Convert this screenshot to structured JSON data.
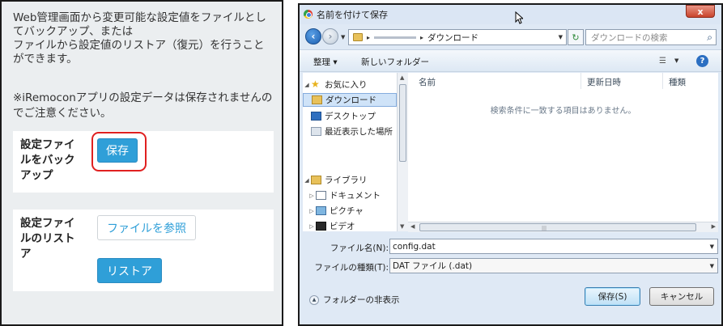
{
  "web_page": {
    "intro_lines": [
      "Web管理画面から変更可能な設定値をファイルとし",
      "てバックアップ、または",
      "ファイルから設定値のリストア（復元）を行うこと",
      "ができます。"
    ],
    "note_lines": [
      "※iRemoconアプリの設定データは保存されませんの",
      "でご注意ください。"
    ],
    "backup_card": {
      "label_lines": [
        "設定ファイ",
        "ルをバック",
        "アップ"
      ],
      "save_button": "保存"
    },
    "restore_card": {
      "label_lines": [
        "設定ファイ",
        "ルのリスト",
        "ア"
      ],
      "browse_button": "ファイルを参照",
      "restore_button": "リストア"
    },
    "colors": {
      "accent": "#2f9fd8",
      "highlight_ring": "#e02020",
      "page_bg": "#ebeef0"
    }
  },
  "dialog": {
    "title": "名前を付けて保存",
    "close_symbol": "x",
    "address": {
      "separator": "▸",
      "current_folder": "ダウンロード"
    },
    "search_placeholder": "ダウンロードの検索",
    "toolbar": {
      "organize": "整理 ▾",
      "new_folder": "新しいフォルダー"
    },
    "nav_tree": [
      {
        "label": "お気に入り",
        "icon": "star-icon",
        "expanded": true
      },
      {
        "label": "ダウンロード",
        "icon": "downloads-folder-icon",
        "selected": true
      },
      {
        "label": "デスクトップ",
        "icon": "desktop-icon"
      },
      {
        "label": "最近表示した場所",
        "icon": "recent-places-icon"
      },
      {
        "label": "ライブラリ",
        "icon": "library-icon",
        "expanded": true
      },
      {
        "label": "ドキュメント",
        "icon": "documents-icon"
      },
      {
        "label": "ピクチャ",
        "icon": "pictures-icon"
      },
      {
        "label": "ビデオ",
        "icon": "videos-icon"
      }
    ],
    "columns": {
      "name": "名前",
      "date": "更新日時",
      "type": "種類"
    },
    "empty_message": "検索条件に一致する項目はありません。",
    "file_name_label": "ファイル名(N):",
    "file_name_value": "config.dat",
    "file_type_label": "ファイルの種類(T):",
    "file_type_value": "DAT ファイル (.dat)",
    "hide_folders": "フォルダーの非表示",
    "save_button": "保存(S)",
    "cancel_button": "キャンセル"
  }
}
